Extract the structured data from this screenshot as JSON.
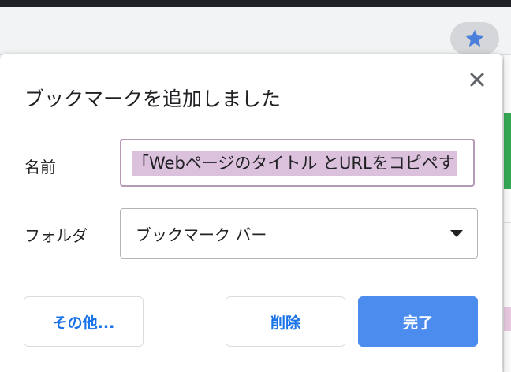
{
  "toolbar": {
    "star_icon": "star-icon",
    "accent": "#4b7fdc"
  },
  "dialog": {
    "title": "ブックマークを追加しました",
    "close_icon": "close-icon",
    "name_label": "名前",
    "name_value": "「Webページのタイトル とURLをコピペす",
    "folder_label": "フォルダ",
    "folder_value": "ブックマーク バー",
    "folder_caret_icon": "caret-down-icon",
    "more_button": "その他...",
    "remove_button": "削除",
    "done_button": "完了",
    "primary_color": "#4c8cee",
    "selection_color": "#dcc1dd"
  }
}
